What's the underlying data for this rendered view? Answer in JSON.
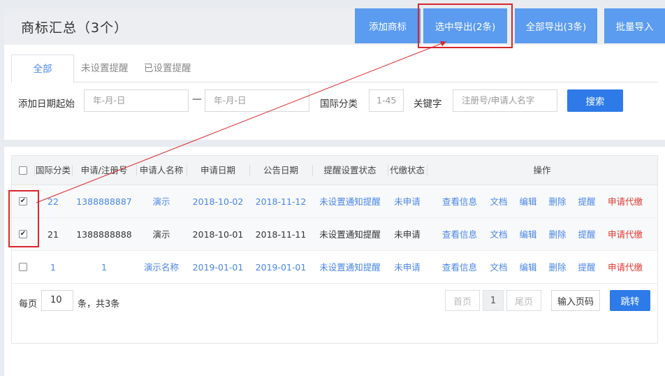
{
  "header": {
    "title": "商标汇总（3个）",
    "buttons": {
      "add": "添加商标",
      "export_selected": "选中导出(2条)",
      "export_all": "全部导出(3条)",
      "batch_import": "批量导入"
    }
  },
  "tabs": [
    "全部",
    "未设置提醒",
    "已设置提醒"
  ],
  "filters": {
    "date_label": "添加日期起始",
    "date_from_placeholder": "年-月-日",
    "date_sep": "—",
    "date_to_placeholder": "年-月-日",
    "class_label": "国际分类",
    "class_placeholder": "1-45",
    "keyword_label": "关键字",
    "keyword_placeholder": "注册号/申请人名字",
    "search_button": "搜索"
  },
  "table": {
    "columns": [
      "国际分类",
      "申请/注册号",
      "申请人名称",
      "申请日期",
      "公告日期",
      "提醒设置状态",
      "代缴状态",
      "操作"
    ],
    "actions": [
      "查看信息",
      "文档",
      "编辑",
      "删除",
      "提醒",
      "申请代缴"
    ],
    "rows": [
      {
        "checked": true,
        "class": "22",
        "reg_no": "1388888887",
        "applicant": "演示",
        "apply_date": "2018-10-02",
        "announce_date": "2018-11-12",
        "reminder": "未设置通知提醒",
        "proxy": "未申请"
      },
      {
        "checked": true,
        "class": "21",
        "reg_no": "1388888888",
        "applicant": "演示",
        "apply_date": "2018-10-01",
        "announce_date": "2018-11-11",
        "reminder": "未设置通知提醒",
        "proxy": "未申请"
      },
      {
        "checked": false,
        "class": "1",
        "reg_no": "1",
        "applicant": "演示名称",
        "apply_date": "2019-01-01",
        "announce_date": "2019-01-01",
        "reminder": "未设置通知提醒",
        "proxy": "未申请"
      }
    ]
  },
  "pagination": {
    "per_page_label": "每页",
    "per_page_value": "10",
    "summary": "条，共3条",
    "first": "首页",
    "current": "1",
    "last": "尾页",
    "input_label": "输入页码",
    "go": "跳转"
  },
  "colors": {
    "accent": "#2d7ae8",
    "header_button": "#5b9bf0",
    "link": "#4a86e8",
    "danger": "#e0382f",
    "annotation": "#d9262c"
  }
}
